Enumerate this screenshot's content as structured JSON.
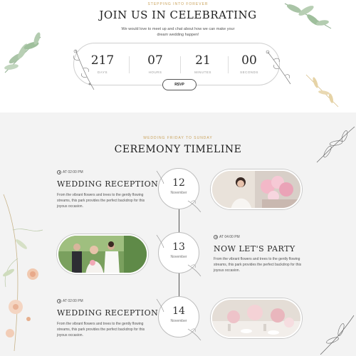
{
  "header": {
    "eyebrow": "STEPPING INTO FOREVER",
    "title": "JOIN US IN CELEBRATING",
    "subtitle": "We would love to meet up and chat about how we can make your dream wedding happen!"
  },
  "countdown": [
    {
      "value": "217",
      "label": "DAYS"
    },
    {
      "value": "07",
      "label": "HOURS"
    },
    {
      "value": "21",
      "label": "MINUTES"
    },
    {
      "value": "00",
      "label": "SECONDS"
    }
  ],
  "rsvp_label": "RSVP",
  "timeline": {
    "eyebrow": "WEDDING FRIDAY TO SUNDAY",
    "title": "CEREMONY TIMELINE",
    "events": [
      {
        "time": "AT 02:00 PM",
        "title": "WEDDING RECEPTION",
        "desc": "From the vibrant flowers and trees to the gently flowing streams, this park provides the perfect backdrop for this joyous occasion.",
        "day": "12",
        "month": "November",
        "photo": "bride-with-flowers-photo"
      },
      {
        "time": "AT 04:00 PM",
        "title": "NOW LET'S PARTY",
        "desc": "From the vibrant flowers and trees to the gently flowing streams, this park provides the perfect backdrop for this joyous occasion.",
        "day": "13",
        "month": "November",
        "photo": "wedding-couple-photo"
      },
      {
        "time": "AT 02:00 PM",
        "title": "WEDDING RECEPTION",
        "desc": "From the vibrant flowers and trees to the gently flowing streams, this park provides the perfect backdrop for this joyous occasion.",
        "day": "14",
        "month": "November",
        "photo": "reception-table-photo"
      }
    ]
  },
  "colors": {
    "accent": "#c9a25a",
    "background_alt": "#f3f3f3",
    "text": "#1d1d1d"
  }
}
